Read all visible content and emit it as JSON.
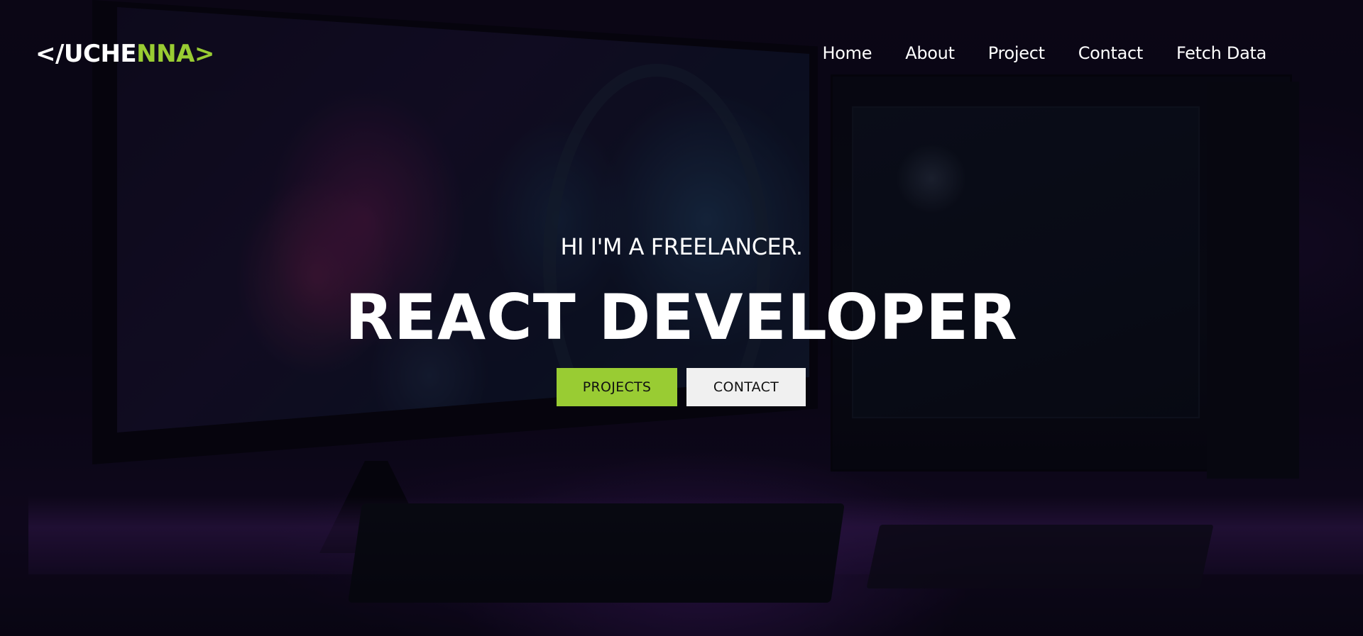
{
  "logo": {
    "open_bracket": "<",
    "slash_text": "/UCHE",
    "accent_text": "NNA",
    "close_bracket": ">"
  },
  "nav": {
    "items": [
      {
        "label": "Home"
      },
      {
        "label": "About"
      },
      {
        "label": "Project"
      },
      {
        "label": "Contact"
      },
      {
        "label": "Fetch Data"
      }
    ]
  },
  "hero": {
    "subtitle": "HI I'M A FREELANCER.",
    "headline": "REACT DEVELOPER",
    "primary_button": "PROJECTS",
    "secondary_button": "CONTACT"
  },
  "colors": {
    "accent": "#99cc33",
    "text": "#ffffff",
    "secondary_button_bg": "#f0f0f0"
  }
}
